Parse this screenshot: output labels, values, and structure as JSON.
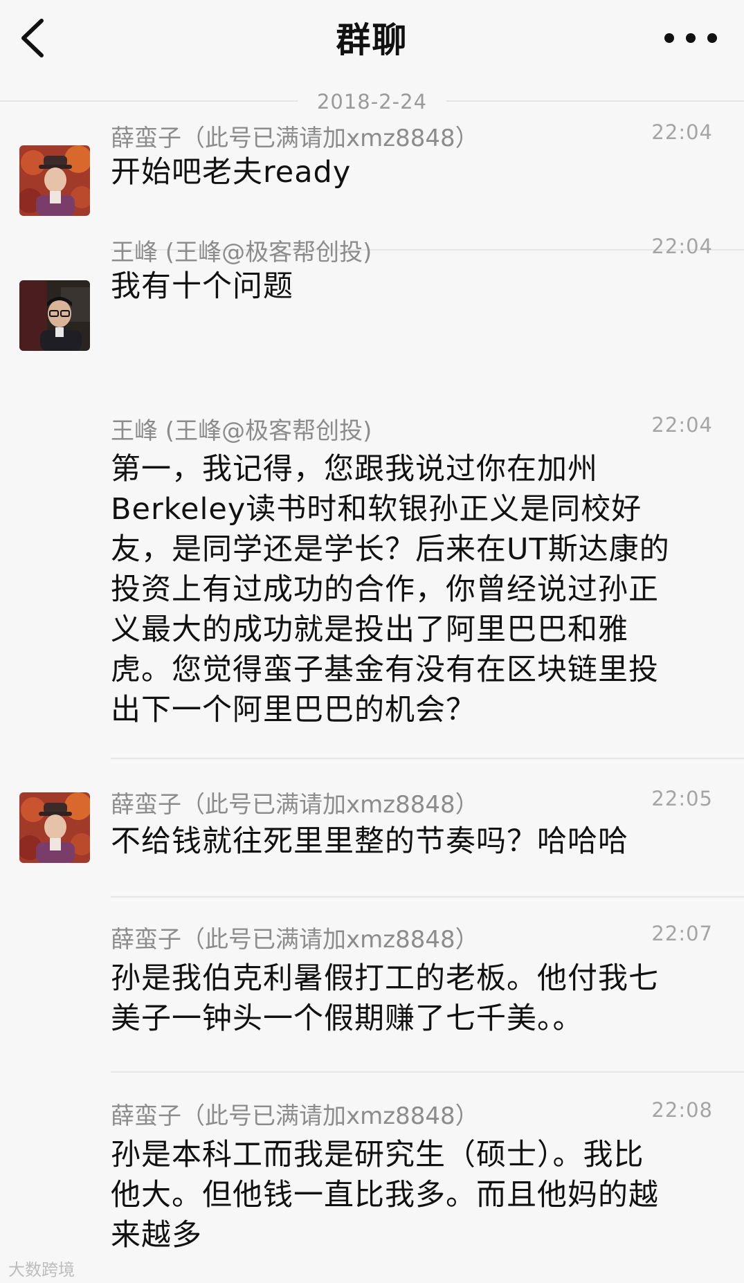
{
  "header": {
    "title": "群聊",
    "back_icon": "chevron-left-icon",
    "more_icon": "more-dots-icon"
  },
  "date_separator": "2018-2-24",
  "messages": [
    {
      "sender": "薛蛮子（此号已满请加xmz8848）",
      "time": "22:04",
      "text": "开始吧老夫ready",
      "avatar": "man-with-hat-avatar"
    },
    {
      "sender": "王峰 (王峰@极客帮创投)",
      "time": "22:04",
      "text": "我有十个问题",
      "avatar": "man-with-glasses-avatar"
    },
    {
      "sender": "王峰 (王峰@极客帮创投)",
      "time": "22:04",
      "text_lines": [
        "第一，我记得，您跟我说过你在加州",
        "Berkeley读书时和软银孙正义是同校好",
        "友，是同学还是学长？后来在UT斯达康的",
        "投资上有过成功的合作，你曾经说过孙正",
        "义最大的成功就是投出了阿里巴巴和雅",
        "虎。您觉得蛮子基金有没有在区块链里投",
        "出下一个阿里巴巴的机会？"
      ]
    },
    {
      "sender": "薛蛮子（此号已满请加xmz8848）",
      "time": "22:05",
      "text": "不给钱就往死里里整的节奏吗？哈哈哈",
      "avatar": "man-with-hat-avatar"
    },
    {
      "sender": "薛蛮子（此号已满请加xmz8848）",
      "time": "22:07",
      "text_lines": [
        "孙是我伯克利暑假打工的老板。他付我七",
        "美子一钟头一个假期赚了七千美。。"
      ]
    },
    {
      "sender": "薛蛮子（此号已满请加xmz8848）",
      "time": "22:08",
      "text_lines": [
        "孙是本科工而我是研究生（硕士）。我比",
        "他大。但他钱一直比我多。而且他妈的越",
        "来越多"
      ]
    }
  ],
  "watermark": "大数跨境",
  "colors": {
    "background": "#f7f7f7",
    "sender_gray": "#8c8c8c",
    "time_gray": "#a5a5a5",
    "divider": "#e6e6e6"
  }
}
